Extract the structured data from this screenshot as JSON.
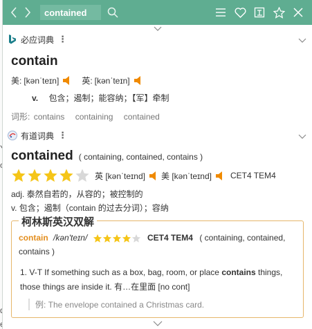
{
  "toolbar": {
    "query": "contained",
    "icons": [
      "chevron-left-icon",
      "chevron-right-icon",
      "search-icon",
      "menu-icon",
      "heart-icon",
      "wordbook-icon",
      "pin-icon",
      "close-icon"
    ]
  },
  "bing": {
    "name": "必应词典",
    "word": "contain",
    "us_label": "美:",
    "us_phonetic": "[kənˈteɪn]",
    "uk_label": "英:",
    "uk_phonetic": "[kənˈteɪn]",
    "pos": "v.",
    "definition": "包含；遏制；能容纳；【军】牵制",
    "forms_label": "词形:",
    "forms": [
      "contains",
      "containing",
      "contained"
    ]
  },
  "youdao": {
    "name": "有道词典",
    "word": "contained",
    "forms": "( containing, contained, contains )",
    "stars_filled": 4,
    "stars_total": 5,
    "uk_phonetic": "英 [kənˈteɪnd]",
    "us_phonetic": "美 [kənˈteɪnd]",
    "levels": "CET4 TEM4",
    "adj_def": "adj. 泰然自若的，从容的；被控制的",
    "v_def": "v. 包含；遏制（contain 的过去分词）；容纳"
  },
  "collins": {
    "title": "柯林斯英汉双解",
    "word": "contain",
    "phonetic": "/kən'teɪn/",
    "stars_filled": 4,
    "stars_total": 5,
    "levels": "CET4 TEM4",
    "forms": "( containing, contained, contains )",
    "sense_num": "1.",
    "sense_pos": "V-T",
    "sense_text_a": "If something such as a box, bag, room, or place",
    "sense_bold": "contains",
    "sense_text_b": "things, those things are inside it. 有…在里面 [no cont]",
    "example": "例: The envelope contained a Christmas card."
  },
  "colors": {
    "accent": "#5fad91",
    "star": "#f5c518",
    "star_empty": "#d8d8d8",
    "speaker": "#f08a00",
    "collins_border": "#e6b66a",
    "collins_word": "#e38e1e"
  }
}
